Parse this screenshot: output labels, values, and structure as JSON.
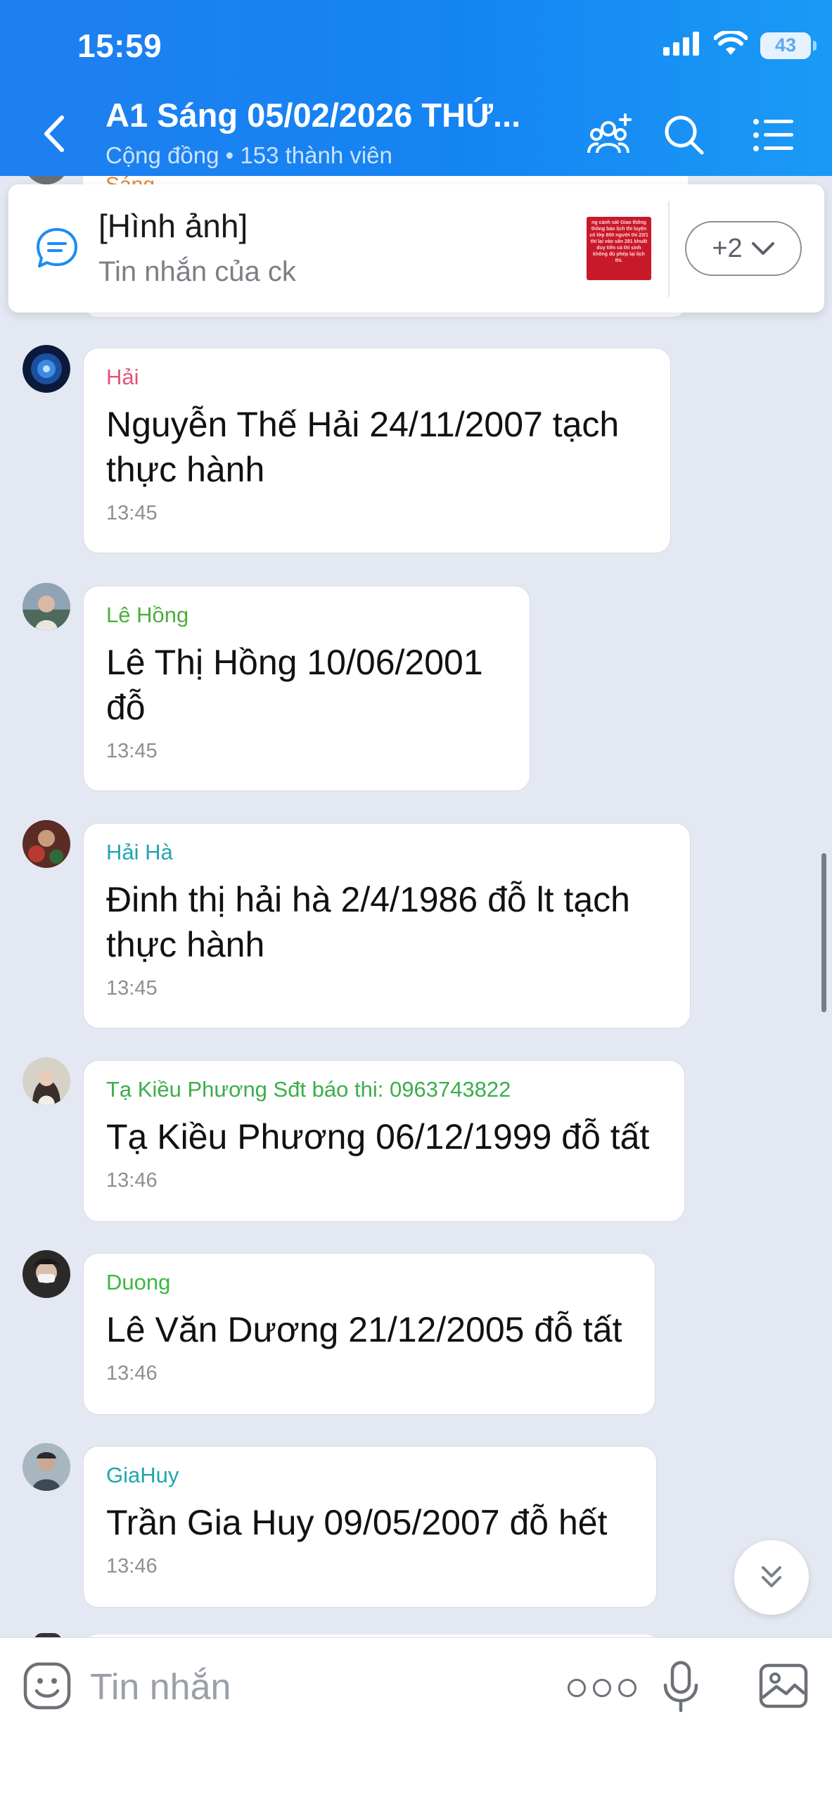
{
  "status_bar": {
    "time": "15:59",
    "battery": "43"
  },
  "header": {
    "title": "A1 Sáng 05/02/2026 THỨ...",
    "subtitle": "Cộng đồng • 153 thành viên"
  },
  "peek_message": {
    "sender": "Sáng"
  },
  "pinned": {
    "title": "[Hình ảnh]",
    "subtitle": "Tin nhắn của ck",
    "thumbnail_text": "ng cảnh sát Giao thông thông báo lịch thi luyện có lớp 800 người thi 23/1 thì lại vào sân 281 khuất duy tiến cả thí sinh không đủ phép lại lịch thi.",
    "more_label": "+2"
  },
  "messages": [
    {
      "sender": "Hải",
      "sender_color": "#e0557a",
      "text": "Nguyễn Thế Hải 24/11/2007 tạch thực hành",
      "time": "13:45"
    },
    {
      "sender": "Lê Hồng",
      "sender_color": "#4cae3c",
      "text": "Lê Thị Hồng 10/06/2001 đỗ",
      "time": "13:45"
    },
    {
      "sender": "Hải Hà",
      "sender_color": "#22a5b0",
      "text": "Đinh thị hải hà 2/4/1986 đỗ lt tạch thực hành",
      "time": "13:45"
    },
    {
      "sender": "Tạ Kiều Phương Sđt báo thi: 0963743822",
      "sender_color": "#3bae4a",
      "text": "Tạ Kiều Phương 06/12/1999 đỗ tất",
      "time": "13:46"
    },
    {
      "sender": "Duong",
      "sender_color": "#3bb840",
      "text": "Lê Văn Dương 21/12/2005 đỗ tất",
      "time": "13:46"
    },
    {
      "sender": "GiaHuy",
      "sender_color": "#22a5b0",
      "text": "Trần Gia Huy 09/05/2007 đỗ hết",
      "time": "13:46"
    }
  ],
  "input": {
    "placeholder": "Tin nhắn"
  },
  "icons": {
    "back": "chevron-left-icon",
    "members": "add-member-icon",
    "search": "search-icon",
    "menu": "list-menu-icon",
    "pinned": "chat-bubble-icon",
    "expand": "chevron-down-icon",
    "scroll_down": "double-chevron-down-icon",
    "emoji": "emoji-icon",
    "more": "more-dots-icon",
    "mic": "microphone-icon",
    "image": "image-icon"
  },
  "colors": {
    "header_blue": "#1584f3",
    "accent_blue": "#1a8df5",
    "background": "#e4e8f2"
  }
}
